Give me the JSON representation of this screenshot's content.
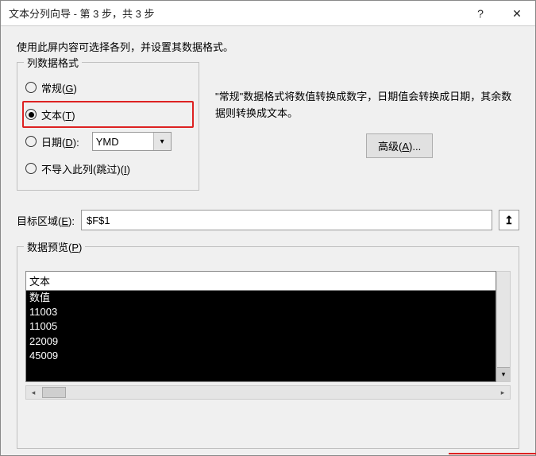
{
  "window": {
    "title": "文本分列向导 - 第 3 步，共 3 步",
    "help_icon": "?",
    "close_icon": "✕"
  },
  "intro": "使用此屏内容可选择各列，并设置其数据格式。",
  "format_group": {
    "legend": "列数据格式",
    "options": {
      "general": "常规(G)",
      "text": "文本(T)",
      "date": "日期(D):",
      "skip": "不导入此列(跳过)(I)"
    },
    "date_value": "YMD",
    "selected": "text"
  },
  "description": "\"常规\"数据格式将数值转换成数字，日期值会转换成日期，其余数据则转换成文本。",
  "advanced_label": "高级(A)...",
  "destination": {
    "label": "目标区域(E):",
    "value": "$F$1"
  },
  "preview": {
    "legend": "数据预览(P)",
    "header": "文本",
    "rows": [
      "数值",
      "11003",
      "11005",
      "22009",
      "45009"
    ]
  }
}
